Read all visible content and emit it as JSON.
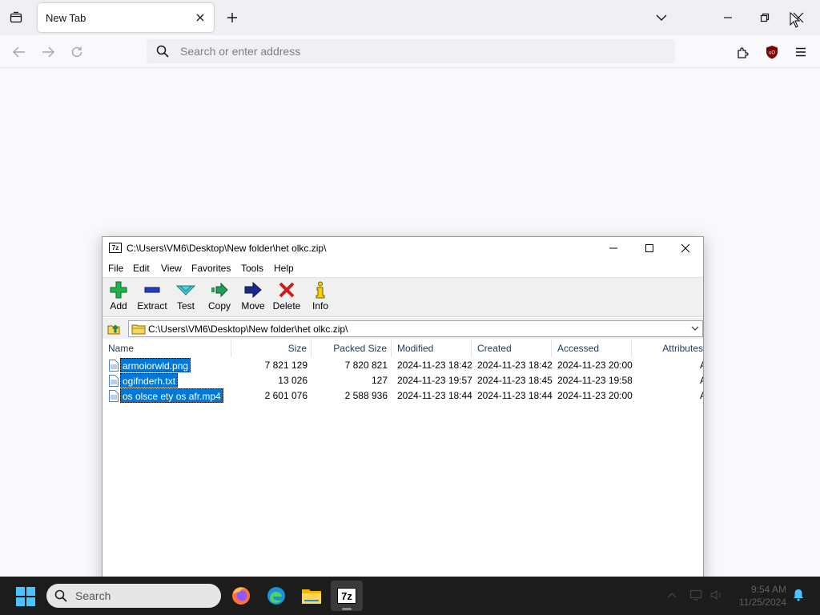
{
  "browser": {
    "tab_title": "New Tab",
    "address_placeholder": "Search or enter address"
  },
  "zip_window": {
    "title": "C:\\Users\\VM6\\Desktop\\New folder\\het olkc.zip\\",
    "app_icon_text": "7z",
    "menu": [
      "File",
      "Edit",
      "View",
      "Favorites",
      "Tools",
      "Help"
    ],
    "toolbar": [
      {
        "label": "Add",
        "icon": "add-icon"
      },
      {
        "label": "Extract",
        "icon": "extract-icon"
      },
      {
        "label": "Test",
        "icon": "test-icon"
      },
      {
        "label": "Copy",
        "icon": "copy-icon"
      },
      {
        "label": "Move",
        "icon": "move-icon"
      },
      {
        "label": "Delete",
        "icon": "delete-icon"
      },
      {
        "label": "Info",
        "icon": "info-icon"
      }
    ],
    "address": "C:\\Users\\VM6\\Desktop\\New folder\\het olkc.zip\\",
    "columns": [
      "Name",
      "Size",
      "Packed Size",
      "Modified",
      "Created",
      "Accessed",
      "Attributes"
    ],
    "files": [
      {
        "name": "armoiorwld.png",
        "size": "7 821 129",
        "packed": "7 820 821",
        "modified": "2024-11-23 18:42",
        "created": "2024-11-23 18:42",
        "accessed": "2024-11-23 20:00",
        "attr": "A"
      },
      {
        "name": "ogifnderh.txt",
        "size": "13 026",
        "packed": "127",
        "modified": "2024-11-23 19:57",
        "created": "2024-11-23 18:45",
        "accessed": "2024-11-23 19:58",
        "attr": "A"
      },
      {
        "name": "os olsce ety os afr.mp4",
        "size": "2 601 076",
        "packed": "2 588 936",
        "modified": "2024-11-23 18:44",
        "created": "2024-11-23 18:44",
        "accessed": "2024-11-23 20:00",
        "attr": "A"
      }
    ],
    "selection_color": "#0078d7"
  },
  "taskbar": {
    "search_label": "Search",
    "apps": [
      "firefox-icon",
      "edge-icon",
      "file-explorer-icon",
      "7zip-icon"
    ],
    "clock_time": "9:54 AM",
    "clock_date": "11/25/2024"
  }
}
